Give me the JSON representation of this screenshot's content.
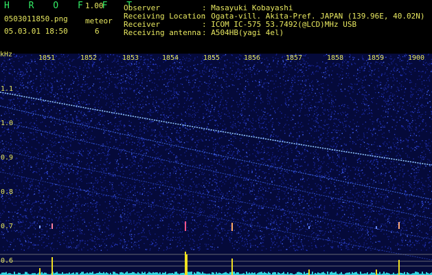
{
  "app": {
    "brand": "H R O F F T",
    "version": "1.00"
  },
  "file": {
    "name": "0503011850.png",
    "date": "05.03.01 18:50"
  },
  "meteor": {
    "label": "meteor",
    "count": "6"
  },
  "info": [
    {
      "key": "Observer",
      "value": ": Masayuki Kobayashi"
    },
    {
      "key": "Receiving Location",
      "value": ": Ogata-vill. Akita-Pref. JAPAN (139.96E, 40.02N)"
    },
    {
      "key": "Receiver",
      "value": ": ICOM IC-575 53.7492(@LCD)MHz USB"
    },
    {
      "key": "Receiving antenna",
      "value": ": A504HB(yagi 4el)"
    }
  ],
  "axis": {
    "unit": "kHz",
    "y_ticks": [
      "1.1",
      "1.0",
      "0.9",
      "0.8",
      "0.7",
      "0.6"
    ],
    "x_ticks": [
      "1851",
      "1852",
      "1853",
      "1854",
      "1855",
      "1856",
      "1857",
      "1858",
      "1859",
      "1900"
    ]
  },
  "colors": {
    "background": "#000000",
    "text": "#e8e860",
    "brand": "#33ee66",
    "noise": "#1a2aa0",
    "trace": "#7fb8ff"
  }
}
